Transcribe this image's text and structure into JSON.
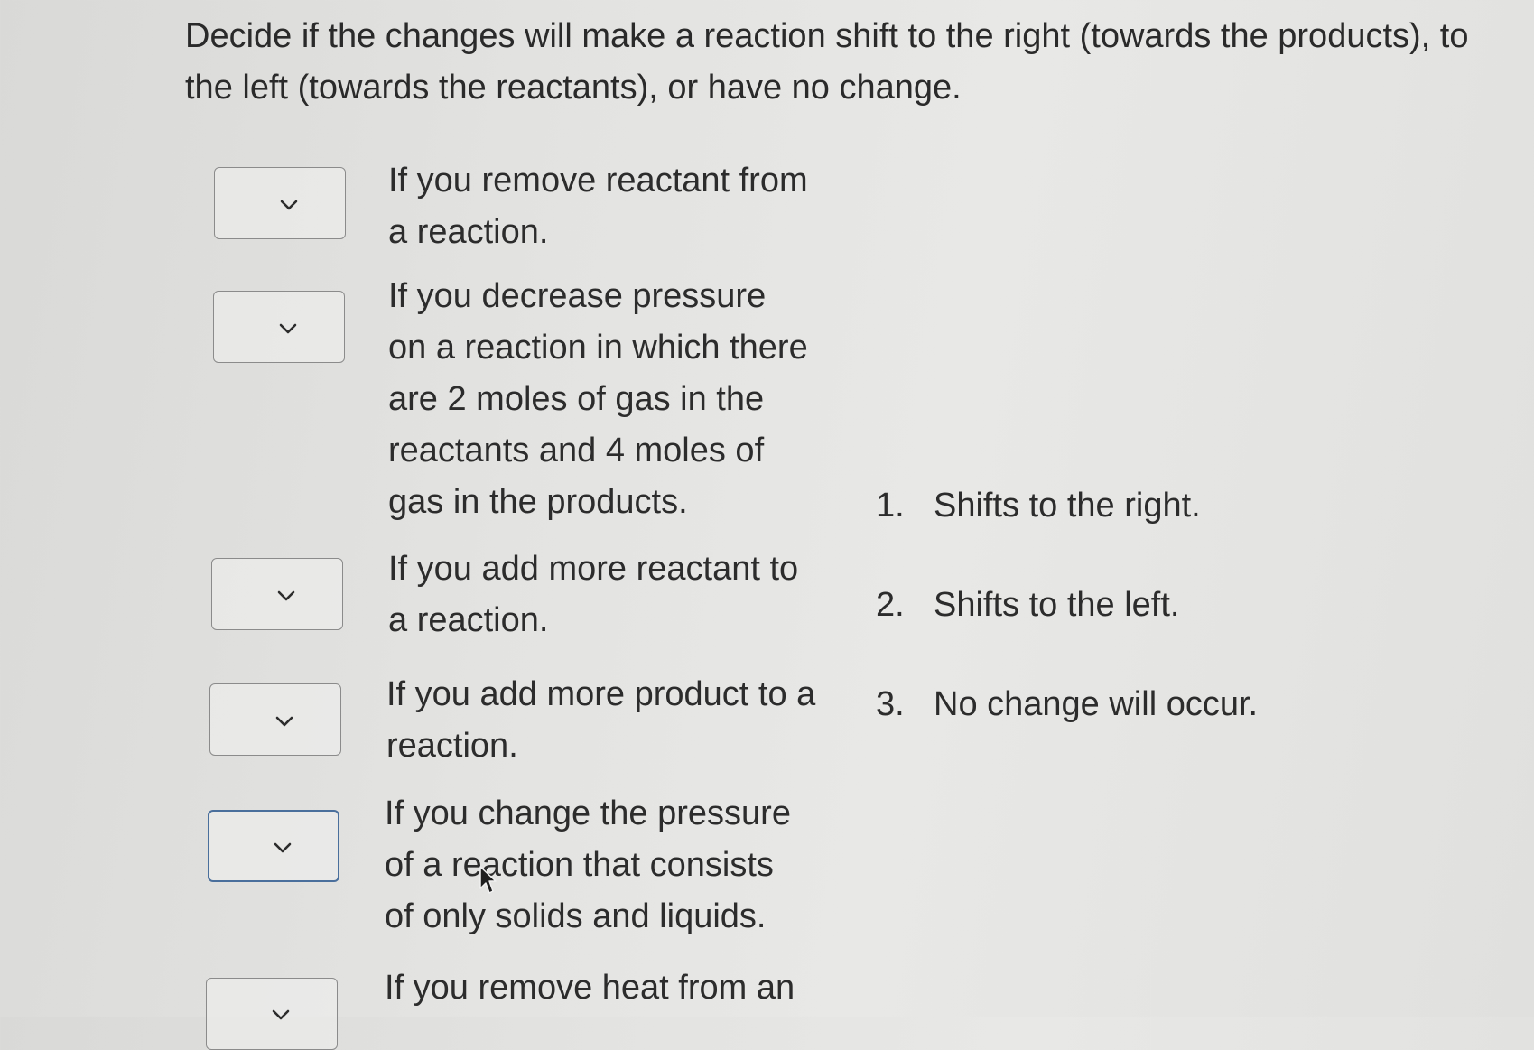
{
  "instructions": "Decide if the changes will make a reaction shift to the right (towards the products), to the left (towards the reactants), or have no change.",
  "questions": [
    {
      "text": "If you remove reactant from a reaction.",
      "selected": ""
    },
    {
      "text": "If you decrease pressure on a reaction in which there are 2 moles of gas in the reactants and 4 moles of gas in the products.",
      "selected": ""
    },
    {
      "text": "If you add more reactant to a reaction.",
      "selected": ""
    },
    {
      "text": "If you add more product to a reaction.",
      "selected": ""
    },
    {
      "text": "If you change the pressure of a reaction that consists of only solids and liquids.",
      "selected": ""
    },
    {
      "text": "If you remove heat from an",
      "selected": ""
    }
  ],
  "options": [
    {
      "number": "1.",
      "label": "Shifts to the right."
    },
    {
      "number": "2.",
      "label": "Shifts to the left."
    },
    {
      "number": "3.",
      "label": "No change will occur."
    }
  ],
  "icons": {
    "dropdown_icon": "chevron-down-icon",
    "pointer_icon": "mouse-cursor-icon"
  },
  "colors": {
    "focused_border": "#4a6f9c"
  }
}
